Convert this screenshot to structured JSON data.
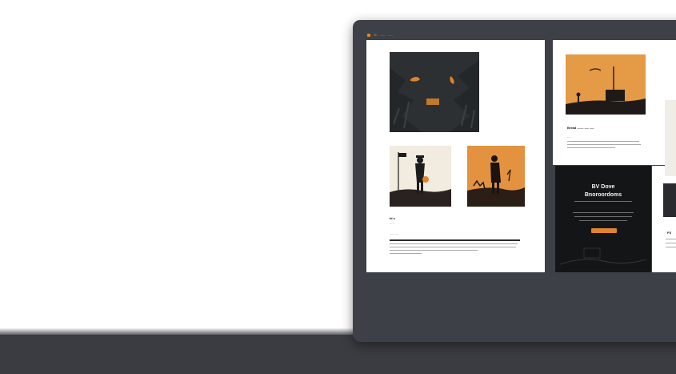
{
  "colors": {
    "accent": "#e0852b",
    "device_frame": "#3d4046",
    "dark_panel": "#141517",
    "floor": "#3a3c41"
  },
  "topbar": {
    "brand": "IIII",
    "nav": [
      "----",
      "-----"
    ]
  },
  "main_panel": {
    "article_title": "Id s",
    "byline": "------",
    "meta": "------ ----"
  },
  "right_panel": {
    "article_title": "Bread ------ ---- ----",
    "meta": "----"
  },
  "dark_panel": {
    "title_line1": "BV Dove",
    "title_line2": "Bnoroordoms"
  },
  "edge_panel": {
    "heading": "FS"
  },
  "icons": [
    "silhouette-art-icon",
    "orange-dot-icon"
  ]
}
